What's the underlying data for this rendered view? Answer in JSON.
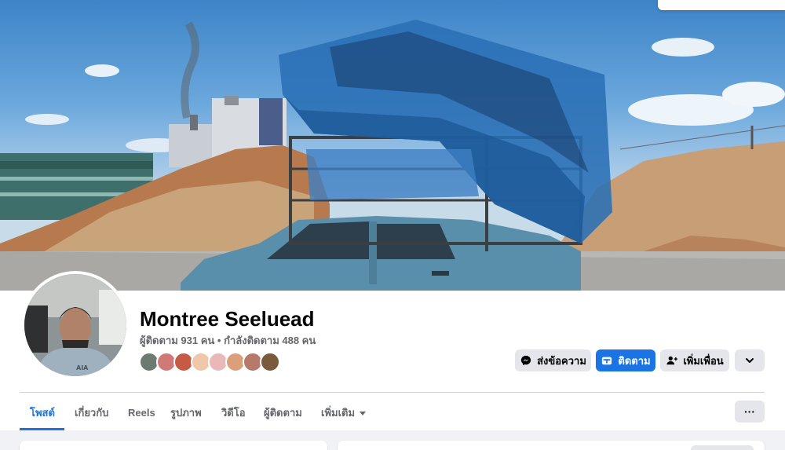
{
  "profile": {
    "name": "Montree Seeluead",
    "stats": "ผู้ติดตาม 931 คน • กำลังติดตาม 488 คน"
  },
  "actions": {
    "message_label": "ส่งข้อความ",
    "follow_label": "ติดตาม",
    "add_friend_label": "เพิ่มเพื่อน"
  },
  "tabs": [
    {
      "label": "โพสต์",
      "active": true
    },
    {
      "label": "เกี่ยวกับ"
    },
    {
      "label": "Reels"
    },
    {
      "label": "รูปภาพ"
    },
    {
      "label": "วิดีโอ"
    },
    {
      "label": "ผู้ติดตาม"
    },
    {
      "label": "เพิ่มเติม"
    }
  ],
  "more_glyph": "···",
  "icons": {
    "message": "messenger-icon",
    "follow": "follow-icon",
    "add_friend": "add-friend-icon",
    "dropdown": "chevron-down-icon",
    "tab_more": "caret-down-icon",
    "more_options": "ellipsis-icon"
  },
  "colors": {
    "accent": "#1b74e4",
    "button_gray": "#e4e6eb",
    "secondary_text": "#65676b",
    "page_bg": "#f0f2f5"
  }
}
